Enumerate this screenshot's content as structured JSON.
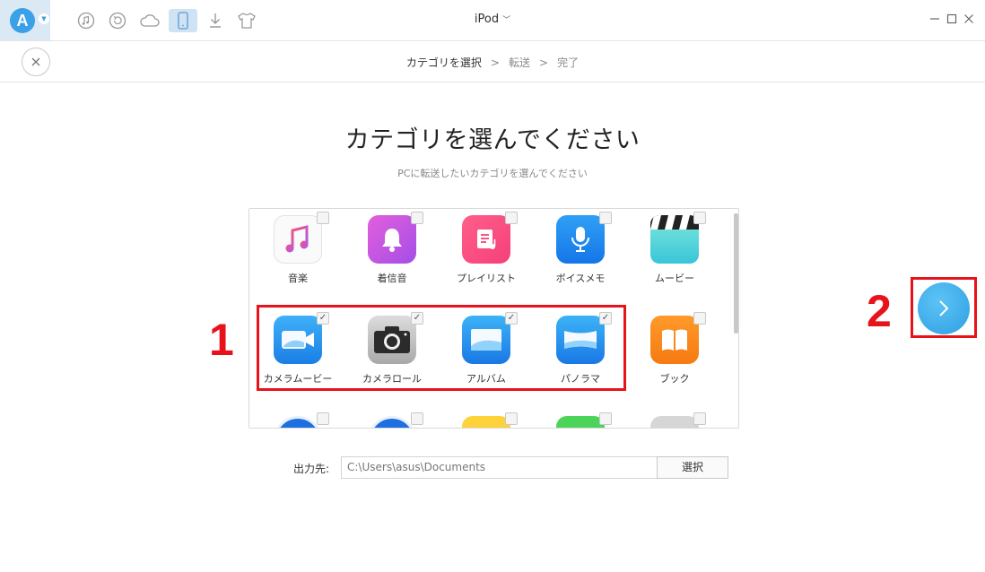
{
  "header": {
    "device_name": "iPod",
    "toolbar": [
      "music-icon",
      "restore-icon",
      "cloud-icon",
      "device-icon",
      "download-icon",
      "tshirt-icon"
    ]
  },
  "steps": {
    "step1": "カテゴリを選択",
    "step2": "転送",
    "step3": "完了",
    "separator": ">"
  },
  "main": {
    "title": "カテゴリを選んでください",
    "subtitle": "PCに転送したいカテゴリを選んでください"
  },
  "categories": [
    {
      "label": "音楽",
      "icon": "music-note-icon",
      "checked": false
    },
    {
      "label": "着信音",
      "icon": "bell-icon",
      "checked": false
    },
    {
      "label": "プレイリスト",
      "icon": "playlist-icon",
      "checked": false
    },
    {
      "label": "ボイスメモ",
      "icon": "microphone-icon",
      "checked": false
    },
    {
      "label": "ムービー",
      "icon": "clapperboard-icon",
      "checked": false
    },
    {
      "label": "カメラムービー",
      "icon": "video-camera-icon",
      "checked": true
    },
    {
      "label": "カメラロール",
      "icon": "camera-icon",
      "checked": true
    },
    {
      "label": "アルバム",
      "icon": "album-icon",
      "checked": true
    },
    {
      "label": "パノラマ",
      "icon": "panorama-icon",
      "checked": true
    },
    {
      "label": "ブック",
      "icon": "book-icon",
      "checked": false
    }
  ],
  "annotations": {
    "one": "1",
    "two": "2"
  },
  "output": {
    "label": "出力先:",
    "path": "C:\\Users\\asus\\Documents",
    "button": "選択"
  },
  "colors": {
    "accent": "#3aa0e8",
    "annotation": "#e8121a"
  }
}
